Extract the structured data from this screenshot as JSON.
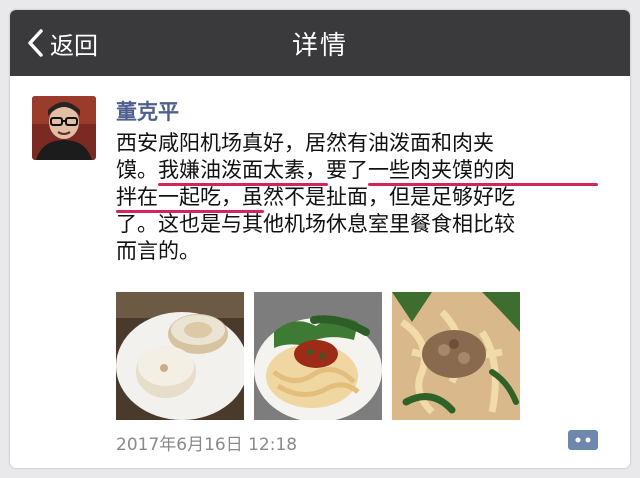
{
  "navbar": {
    "back_label": "返回",
    "title": "详情"
  },
  "post": {
    "author": "董克平",
    "lines": [
      "西安咸阳机场真好，居然有油泼面和肉夹",
      "馍。我嫌油泼面太素，要了一些肉夹馍的肉",
      "拌在一起吃，虽然不是扯面，但是足够好吃",
      "了。这也是与其他机场休息室里餐食相比较",
      "而言的。"
    ],
    "timestamp": "2017年6月16日 12:18"
  },
  "colors": {
    "navbar": "#3a3a3d",
    "author": "#4f5f8f",
    "highlight": "#d6245a",
    "comment_icon": "#6f86ad"
  },
  "icons": {
    "back": "chevron-left-icon",
    "comment": "comment-icon"
  }
}
